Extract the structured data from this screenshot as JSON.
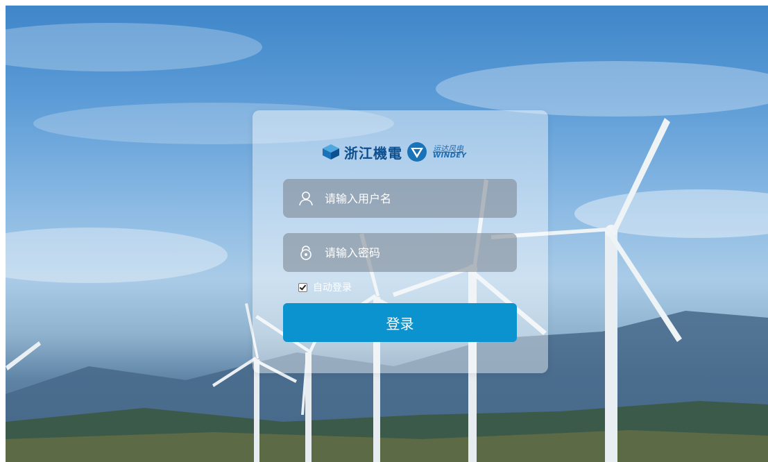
{
  "brand": {
    "company_name": "浙江機電",
    "windey_name_cn": "运达风电",
    "windey_name_en": "WINDEY"
  },
  "login_form": {
    "username_placeholder": "请输入用户名",
    "password_placeholder": "请输入密码",
    "auto_login_label": "自动登录",
    "auto_login_checked": true,
    "submit_label": "登录"
  },
  "colors": {
    "submit_button": "#0b93cf",
    "logo_blue": "#0e4f8f"
  },
  "icons": {
    "username": "user-icon",
    "password": "lock-icon"
  }
}
